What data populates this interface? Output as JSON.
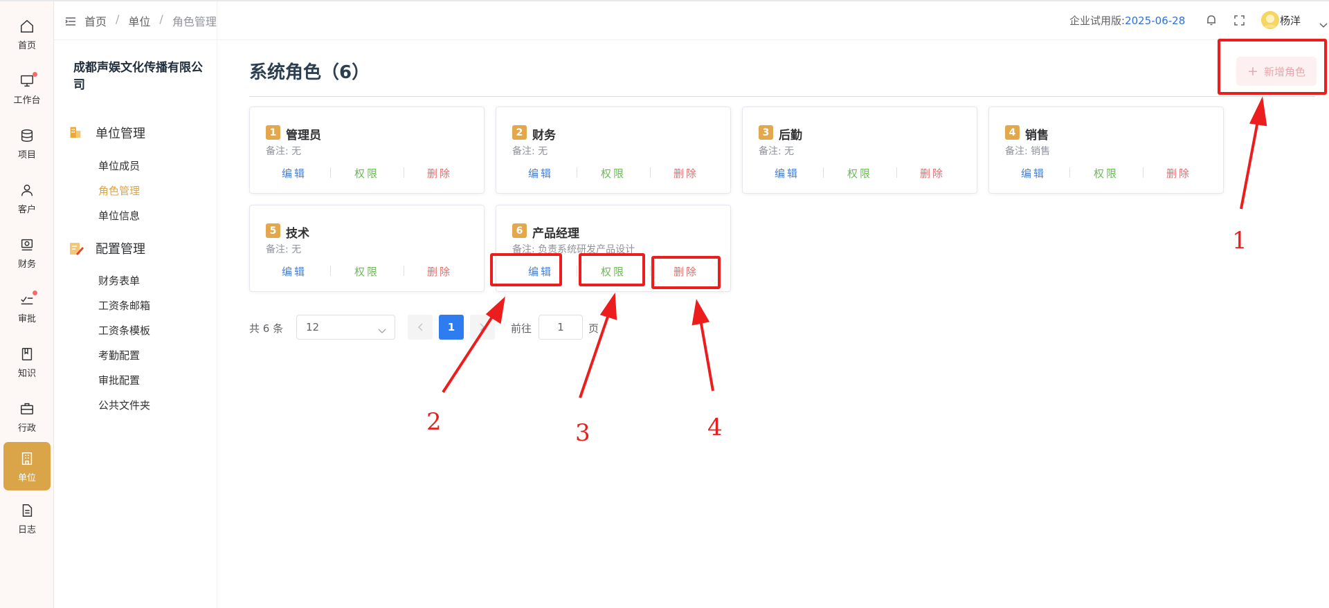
{
  "rail": {
    "items": [
      {
        "label": "首页",
        "icon": "home-icon",
        "dot": false,
        "active": false
      },
      {
        "label": "工作台",
        "icon": "monitor-icon",
        "dot": true,
        "active": false
      },
      {
        "label": "项目",
        "icon": "database-icon",
        "dot": false,
        "active": false
      },
      {
        "label": "客户",
        "icon": "user-icon",
        "dot": false,
        "active": false
      },
      {
        "label": "财务",
        "icon": "finance-icon",
        "dot": false,
        "active": false
      },
      {
        "label": "审批",
        "icon": "approval-icon",
        "dot": true,
        "active": false
      },
      {
        "label": "知识",
        "icon": "book-icon",
        "dot": false,
        "active": false
      },
      {
        "label": "行政",
        "icon": "briefcase-icon",
        "dot": false,
        "active": false
      },
      {
        "label": "单位",
        "icon": "building-icon",
        "dot": false,
        "active": true
      },
      {
        "label": "日志",
        "icon": "document-icon",
        "dot": false,
        "active": false
      }
    ]
  },
  "sidebar": {
    "org_name": "成都声娱文化传播有限公司",
    "groups": [
      {
        "label": "单位管理",
        "icon": "building-icon",
        "items": [
          "单位成员",
          "角色管理",
          "单位信息"
        ]
      },
      {
        "label": "配置管理",
        "icon": "edit-note-icon",
        "items": [
          "财务表单",
          "工资条邮箱",
          "工资条模板",
          "考勤配置",
          "审批配置",
          "公共文件夹"
        ]
      }
    ],
    "active_item": "角色管理"
  },
  "header": {
    "breadcrumb": [
      "首页",
      "单位",
      "角色管理"
    ],
    "breadcrumb_sep": "/",
    "trial_label": "企业试用版:",
    "trial_date": "2025-06-28",
    "user_name": "杨洋"
  },
  "main": {
    "title": "系统角色（6）",
    "add_button": "新增角色",
    "note_prefix": "备注: ",
    "actions": {
      "edit": "编辑",
      "perm": "权限",
      "del": "删除"
    },
    "roles": [
      {
        "index": "1",
        "name": "管理员",
        "note": "无"
      },
      {
        "index": "2",
        "name": "财务",
        "note": "无"
      },
      {
        "index": "3",
        "name": "后勤",
        "note": "无"
      },
      {
        "index": "4",
        "name": "销售",
        "note": "销售"
      },
      {
        "index": "5",
        "name": "技术",
        "note": "无"
      },
      {
        "index": "6",
        "name": "产品经理",
        "note": "负责系统研发产品设计"
      }
    ]
  },
  "pagination": {
    "total": "共 6 条",
    "page_size": "12",
    "current_page": "1",
    "goto_label": "前往",
    "goto_value": "1",
    "page_suffix": "页"
  },
  "annotations": [
    "1",
    "2",
    "3",
    "4"
  ],
  "colors": {
    "accent": "#d9a548",
    "primary": "#2e7cf0",
    "edit": "#4a7fd6",
    "perm": "#6abb55",
    "delete": "#e26d6d",
    "annotation": "#ec1d1d"
  }
}
